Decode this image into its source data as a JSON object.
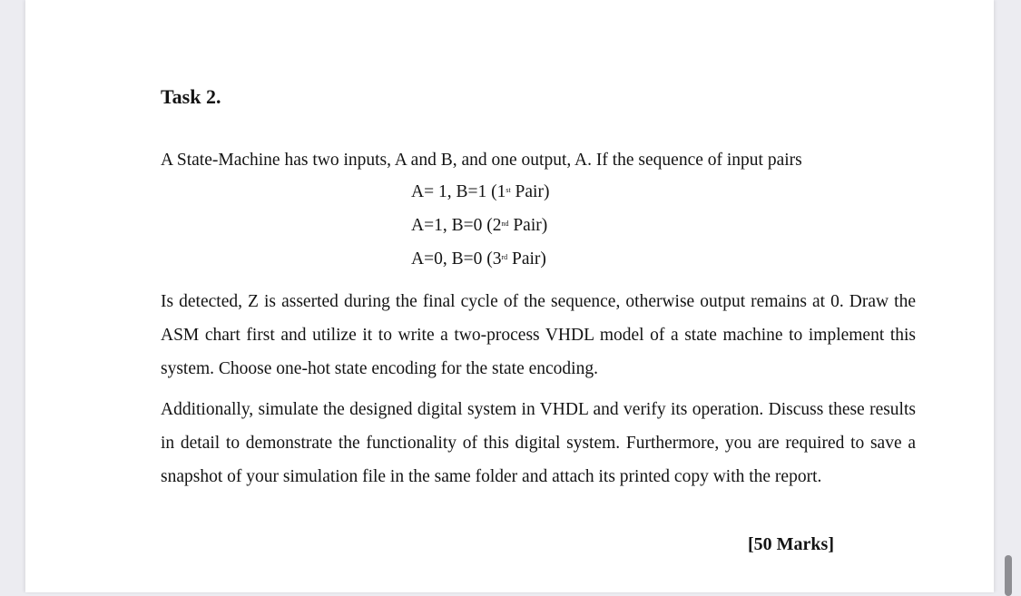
{
  "document": {
    "title": "Task 2.",
    "intro": "A State-Machine has two inputs, A and B, and one output, A. If the sequence of input pairs",
    "pairs": [
      {
        "text": "A= 1, B=1 (1",
        "ordinal": "st",
        "suffix": " Pair)"
      },
      {
        "text": "A=1, B=0 (2",
        "ordinal": "nd",
        "suffix": " Pair)"
      },
      {
        "text": "A=0, B=0 (3",
        "ordinal": "rd",
        "suffix": " Pair)"
      }
    ],
    "paragraph1": "Is detected, Z is asserted during the final cycle of the sequence, otherwise output remains at 0. Draw the ASM chart first and utilize it to write a two-process VHDL model of a state machine to implement this system. Choose one-hot state encoding for the state encoding.",
    "paragraph2": "Additionally, simulate the designed digital system in VHDL and verify its operation. Discuss these results in detail to demonstrate the functionality of this digital system. Furthermore, you are required to save a snapshot of your simulation file in the same folder and attach its printed copy with the report.",
    "marks": "[50 Marks]"
  },
  "viewer": {
    "scrollbar": "vertical-scrollbar"
  }
}
